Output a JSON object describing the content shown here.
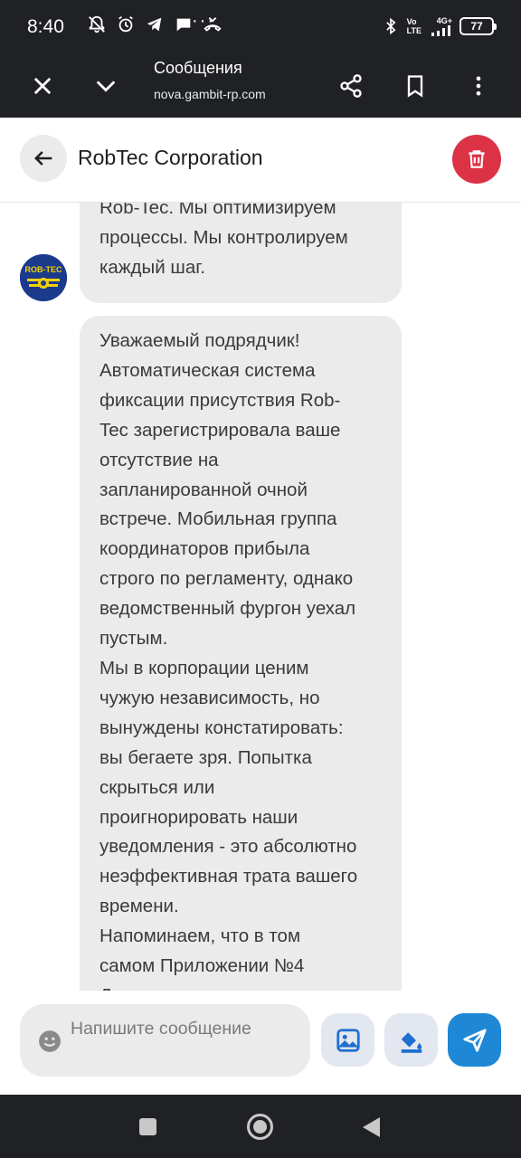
{
  "status_bar": {
    "time": "8:40",
    "overflow": "···",
    "network_label_top": "Vo",
    "network_label_bottom": "LTE",
    "signal_label": "4G+",
    "battery": "77",
    "icons": [
      "mute-bell-icon",
      "alarm-icon",
      "telegram-icon",
      "chat-icon",
      "missed-call-icon",
      "bluetooth-icon",
      "signal-icon"
    ]
  },
  "browser_bar": {
    "title": "Сообщения",
    "url": "nova.gambit-rp.com",
    "icons": [
      "close-icon",
      "chevron-down-icon",
      "share-icon",
      "bookmark-icon",
      "more-vert-icon"
    ]
  },
  "chat_header": {
    "name": "RobTec Corporation",
    "icons": [
      "back-arrow-icon",
      "trash-icon"
    ]
  },
  "avatar": {
    "label": "ROB-TEC",
    "colors": {
      "background": "#1c3a8c",
      "accent": "#f3d200"
    }
  },
  "messages": [
    {
      "lines": [
        "Rob-Tec. Мы оптимизируем",
        "процессы. Мы контролируем",
        "каждый шаг."
      ]
    },
    {
      "lines": [
        "Уважаемый подрядчик!",
        "Автоматическая система",
        "фиксации присутствия Rob-",
        "Tec зарегистрировала ваше",
        "отсутствие на",
        "запланированной очной",
        "встрече. Мобильная группа",
        "координаторов прибыла",
        "строго по регламенту, однако",
        "ведомственный фургон уехал",
        "пустым.",
        "Мы в корпорации ценим",
        "чужую независимость, но",
        "вынуждены констатировать:",
        "вы бегаете зря. Попытка",
        "скрыться или",
        "проигнорировать наши",
        "уведомления - это абсолютно",
        "неэффективная трата вашего",
        "времени.",
        "Напоминаем, что в том",
        "самом Приложении №4",
        "Д"
      ]
    }
  ],
  "composer": {
    "placeholder": "Напишите сообщение",
    "icons": [
      "emoji-icon",
      "image-icon",
      "paint-bucket-icon",
      "send-icon"
    ],
    "colors": {
      "send": "#1e88d6",
      "action_bg": "#e3e7ef",
      "icon": "#1e6fd0"
    }
  },
  "nav_bar": {
    "icons": [
      "recents-square-icon",
      "home-circle-icon",
      "back-triangle-icon"
    ]
  },
  "colors": {
    "delete": "#dc3245",
    "bubble": "#ebebeb",
    "dark_bar": "#202124"
  }
}
